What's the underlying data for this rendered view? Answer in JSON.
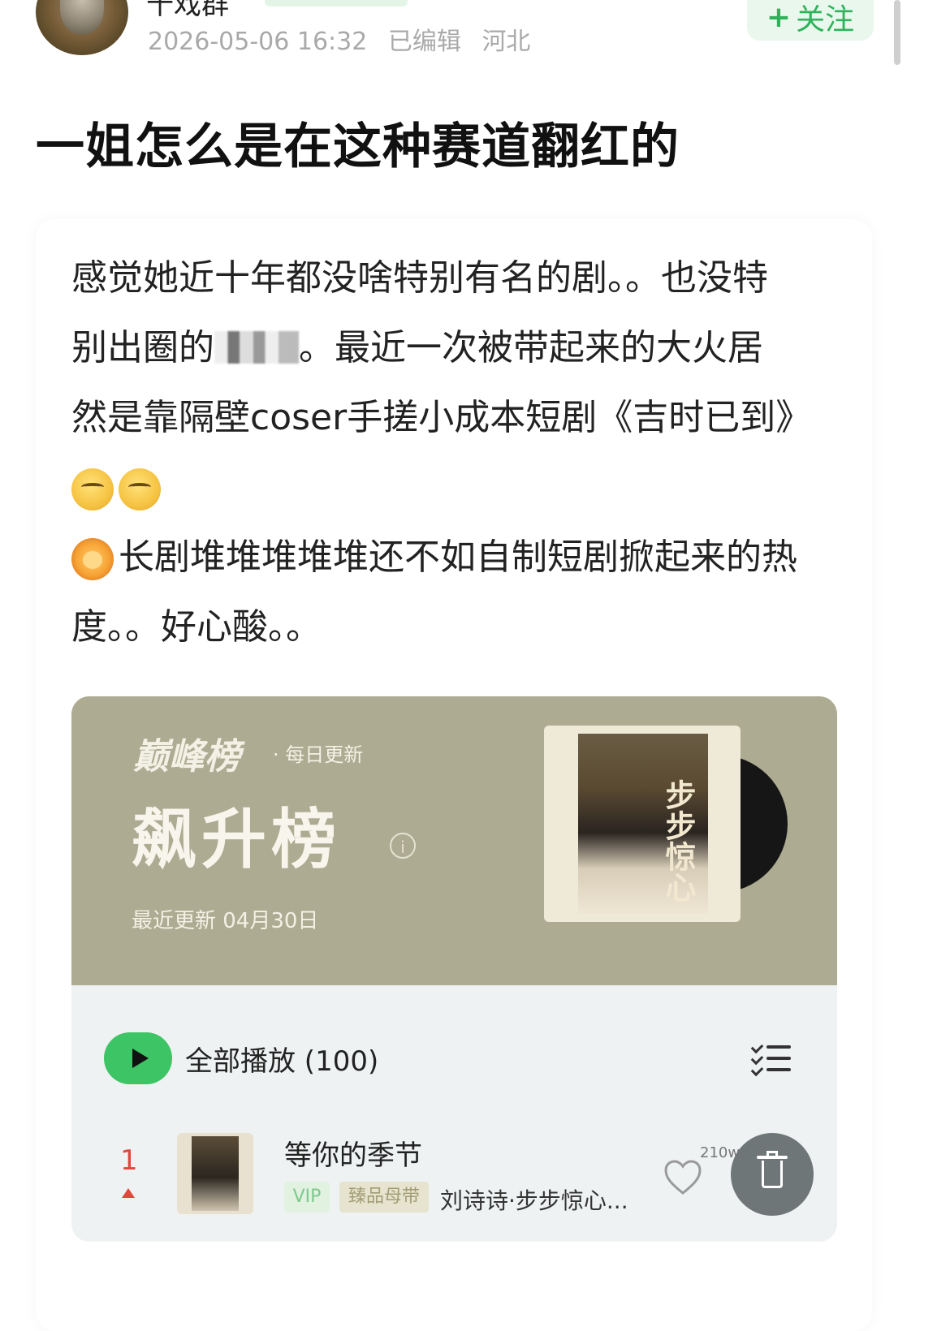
{
  "post": {
    "username": "十戏群",
    "meta": {
      "date": "2026-05-06 16:32",
      "edited": "已编辑",
      "location": "河北"
    },
    "follow_label": "关注",
    "title": "一姐怎么是在这种赛道翻红的",
    "paragraphs": [
      "感觉她近十年都没啥特别有名的剧。。也没特",
      "别出圈的",
      "。最近一次被带起来的大火居",
      "然是靠隔壁coser手搓小成本短剧《吉时已到》",
      "长剧堆堆堆堆堆还不如自制短剧掀起来的热",
      "度。。好心酸。。"
    ],
    "emojis": [
      "thinking-face",
      "thinking-face",
      "lion-face"
    ]
  },
  "embed": {
    "brand": "巅峰榜",
    "daily_update": "· 每日更新",
    "rank_name": "飙升榜",
    "updated": "最近更新 04月30日",
    "album_calligraphy": "步步惊心",
    "play_all": "全部播放 (100)",
    "songs": [
      {
        "rank": "1",
        "title": "等你的季节",
        "tag_vip": "VIP",
        "tag_premium": "臻品母带",
        "subtitle": "刘诗诗·步步惊心...",
        "plays": "210w+"
      }
    ]
  },
  "colors": {
    "accent_green": "#2fb35a",
    "banner": "#adab91",
    "rank_red": "#e0483c"
  }
}
